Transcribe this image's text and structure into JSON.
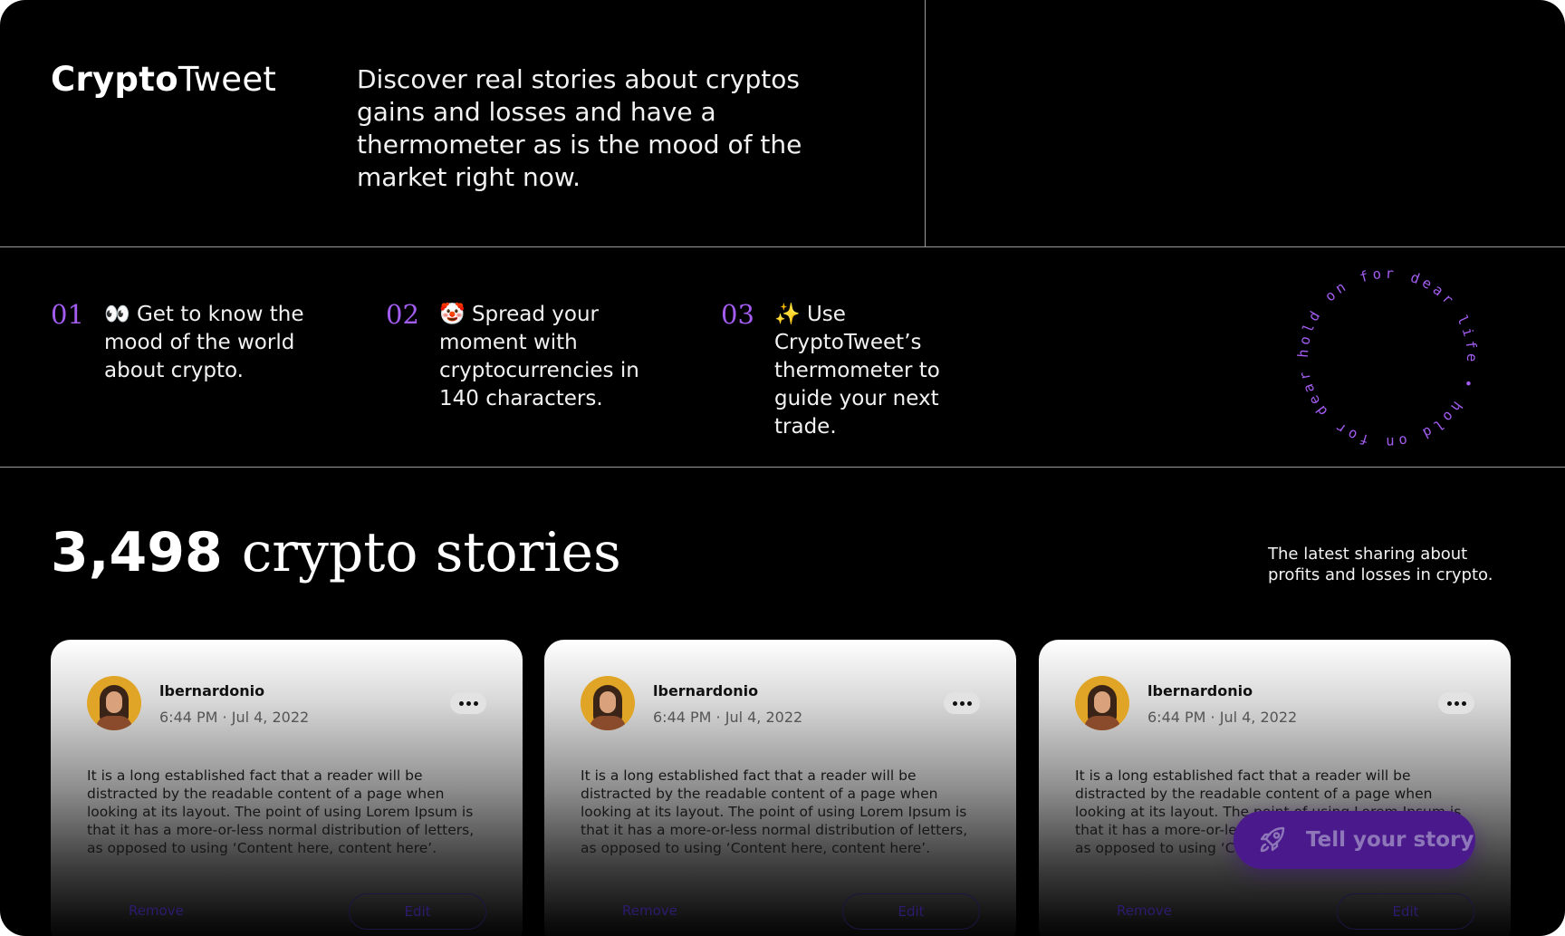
{
  "brand": {
    "bold": "Crypto",
    "light": "Tweet"
  },
  "tagline": "Discover real stories about cryptos gains and losses and have a thermometer as is the mood of the market right now.",
  "features": [
    {
      "num": "01",
      "emoji": "👀",
      "text": "Get to know the mood of the world about crypto."
    },
    {
      "num": "02",
      "emoji": "🤡",
      "text": "Spread your moment with cryptocurrencies in 140 characters."
    },
    {
      "num": "03",
      "emoji": "✨",
      "text": "Use CryptoTweet’s thermometer to guide your next trade."
    }
  ],
  "ring_text": "hold on for dear life • hold on for dear life •",
  "stories": {
    "count": "3,498",
    "label": "crypto stories",
    "subtitle": "The latest sharing about profits and losses in crypto."
  },
  "cards": [
    {
      "username": "lbernardonio",
      "timestamp": "6:44 PM · Jul 4, 2022",
      "body": "It is a long established fact that a reader will be distracted by the readable content of a page when looking at its layout. The point of using Lorem Ipsum is that it has a more-or-less normal distribution of letters, as opposed to using ‘Content here, content here’.",
      "remove_label": "Remove",
      "edit_label": "Edit"
    },
    {
      "username": "lbernardonio",
      "timestamp": "6:44 PM · Jul 4, 2022",
      "body": "It is a long established fact that a reader will be distracted by the readable content of a page when looking at its layout. The point of using Lorem Ipsum is that it has a more-or-less normal distribution of letters, as opposed to using ‘Content here, content here’.",
      "remove_label": "Remove",
      "edit_label": "Edit"
    },
    {
      "username": "lbernardonio",
      "timestamp": "6:44 PM · Jul 4, 2022",
      "body": "It is a long established fact that a reader will be distracted by the readable content of a page when looking at its layout. The point of using Lorem Ipsum is that it has a more-or-less normal distribution of letters, as opposed to using ‘Content here, content here’.",
      "remove_label": "Remove",
      "edit_label": "Edit"
    }
  ],
  "fab": {
    "label": "Tell your story",
    "icon": "rocket-icon"
  },
  "colors": {
    "accent": "#a35cf0",
    "fab": "#4a1a8c",
    "background": "#000000"
  }
}
